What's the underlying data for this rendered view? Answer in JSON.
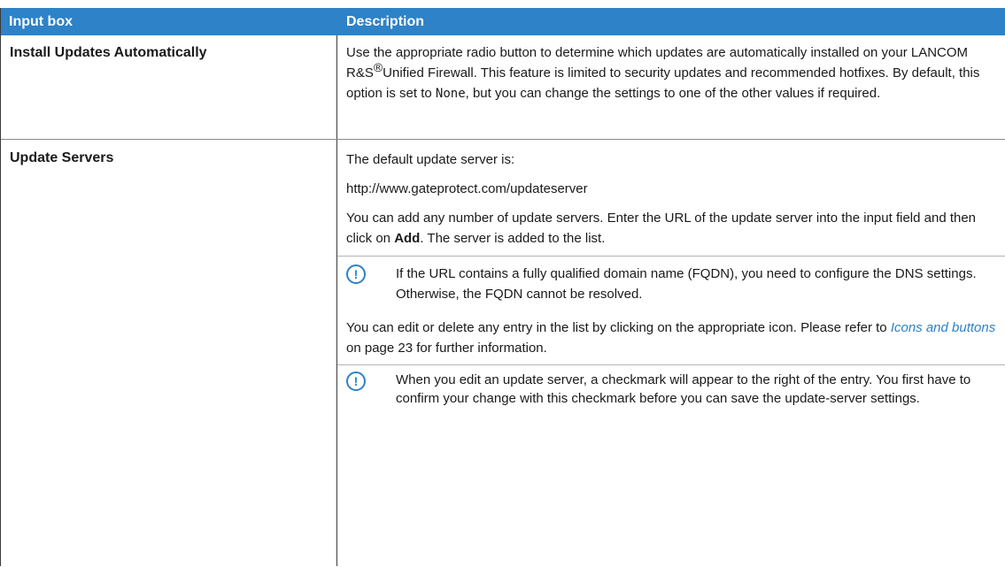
{
  "table": {
    "headers": {
      "col1": "Input box",
      "col2": "Description"
    },
    "row1": {
      "label": "Install Updates Automatically",
      "desc_a": "Use the appropriate radio button to determine which updates are automatically installed on your LANCOM R&S",
      "reg": "®",
      "desc_b": "Unified Firewall. This feature is limited to security updates and recommended hotfixes. By default, this option is set to ",
      "none_value": "None",
      "desc_c": ", but you can change the settings to one of the other values if required."
    },
    "row2": {
      "label": "Update Servers",
      "para1": "The default update server is:",
      "url": "http://www.gateprotect.com/updateserver",
      "para3_a": "You can add any number of update servers. Enter the URL of the update server into the input field and then click on ",
      "para3_bold": "Add",
      "para3_b": ". The server is added to the list.",
      "note1": "If the URL contains a fully qualified domain name (FQDN), you need to configure the DNS settings. Otherwise, the FQDN cannot be resolved.",
      "para4_a": "You can edit or delete any entry in the list by clicking on the appropriate icon. Please refer to ",
      "para4_link": "Icons and buttons",
      "para4_b": " on page 23 for further information.",
      "note2": "When you edit an update server, a checkmark will appear to the right of the entry. You first have to confirm your change with this checkmark before you can save the update-server settings.",
      "note_icon_glyph": "!"
    }
  },
  "colors": {
    "header_bg": "#2d82c8",
    "link": "#2d82c8",
    "icon": "#2d82c8"
  }
}
